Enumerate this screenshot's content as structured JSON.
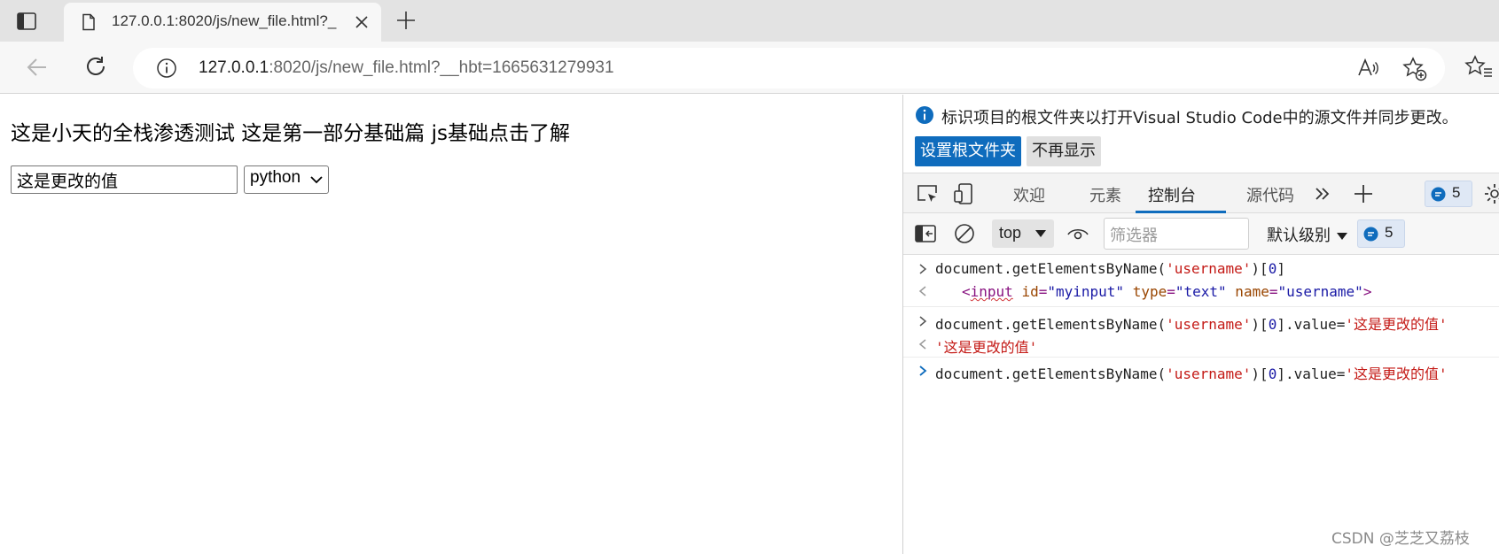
{
  "browser": {
    "tab_title": "127.0.0.1:8020/js/new_file.html?__hbt=1665631279931",
    "tab_title_visible": "127.0.0.1:8020/js/new_file.html?_",
    "url_host": "127.0.0.1",
    "url_rest": ":8020/js/new_file.html?__hbt=1665631279931"
  },
  "page": {
    "heading": "这是小天的全栈渗透测试 这是第一部分基础篇 js基础点击了解",
    "input_value": "这是更改的值",
    "select_value": "python"
  },
  "devtools": {
    "info_text": "标识项目的根文件夹以打开Visual Studio Code中的源文件并同步更改。",
    "set_root_button": "设置根文件夹",
    "dont_show_button": "不再显示",
    "tabs": [
      "欢迎",
      "元素",
      "控制台",
      "源代码"
    ],
    "active_tab": "控制台",
    "messages_count": "5",
    "context": "top",
    "filter_placeholder": "筛选器",
    "level": "默认级别",
    "issues_count": "5",
    "console": {
      "cmd1": {
        "prefix": "document.getElementsByName(",
        "arg": "'username'",
        "mid": ")[",
        "idx": "0",
        "suffix": "]"
      },
      "result1": {
        "open": "<",
        "tag": "input",
        "a1": " id",
        "e1": "=",
        "v1": "\"myinput\"",
        "a2": " type",
        "e2": "=",
        "v2": "\"text\"",
        "a3": " name",
        "e3": "=",
        "v3": "\"username\"",
        "close": ">"
      },
      "cmd2": {
        "prefix": "document.getElementsByName(",
        "arg": "'username'",
        "mid": ")[",
        "idx": "0",
        "suffix": "].value=",
        "value": "'这是更改的值'"
      },
      "result2": "'这是更改的值'",
      "cmd3": {
        "prefix": "document.getElementsByName(",
        "arg": "'username'",
        "mid": ")[",
        "idx": "0",
        "suffix": "].value=",
        "value": "'这是更改的值'"
      }
    }
  },
  "watermark": "CSDN @芝芝又荔枝",
  "colors": {
    "accent": "#0f6cbd",
    "string": "#c41a16",
    "number": "#1a1aa6",
    "tag": "#881280",
    "attr": "#994500"
  }
}
